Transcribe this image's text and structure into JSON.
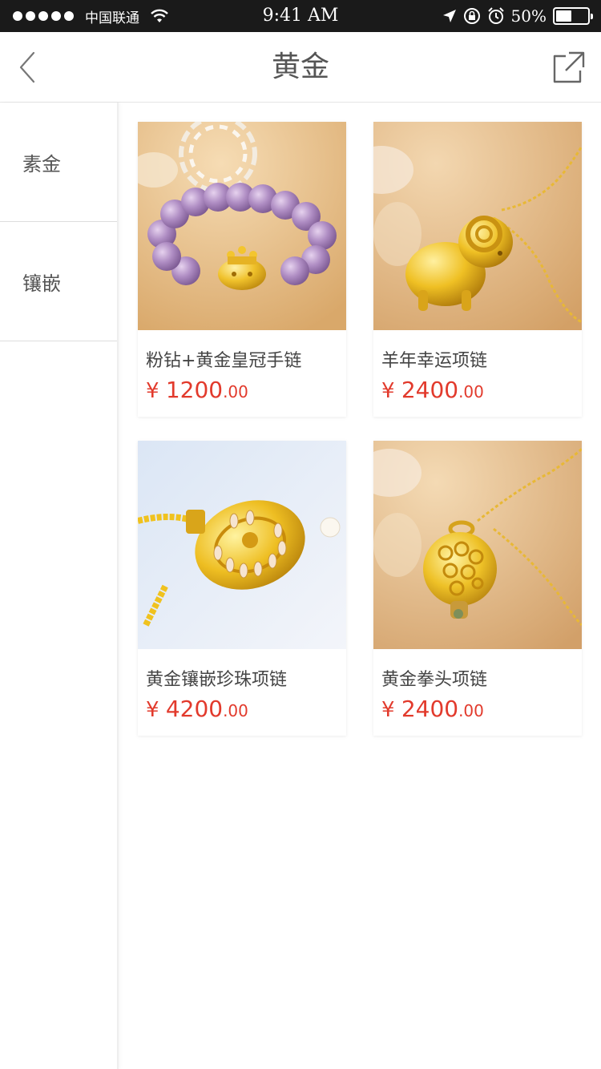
{
  "status_bar": {
    "carrier": "中国联通",
    "time": "9:41 AM",
    "battery": "50%",
    "battery_level": 0.5
  },
  "nav": {
    "title": "黄金",
    "back_icon": "chevron-left-icon",
    "share_icon": "share-external-icon"
  },
  "sidebar": {
    "items": [
      {
        "label": "素金"
      },
      {
        "label": "镶嵌"
      }
    ]
  },
  "products": [
    {
      "name": "粉钻+黄金皇冠手链",
      "currency": "¥ ",
      "price_int": "1200",
      "price_dec": ".00"
    },
    {
      "name": "羊年幸运项链",
      "currency": "¥ ",
      "price_int": "2400",
      "price_dec": ".00"
    },
    {
      "name": "黄金镶嵌珍珠项链",
      "currency": "¥ ",
      "price_int": "4200",
      "price_dec": ".00"
    },
    {
      "name": "黄金拳头项链",
      "currency": "¥ ",
      "price_int": "2400",
      "price_dec": ".00"
    }
  ],
  "colors": {
    "price": "#e23a2c",
    "status_bar_bg": "#1a1a1a"
  }
}
